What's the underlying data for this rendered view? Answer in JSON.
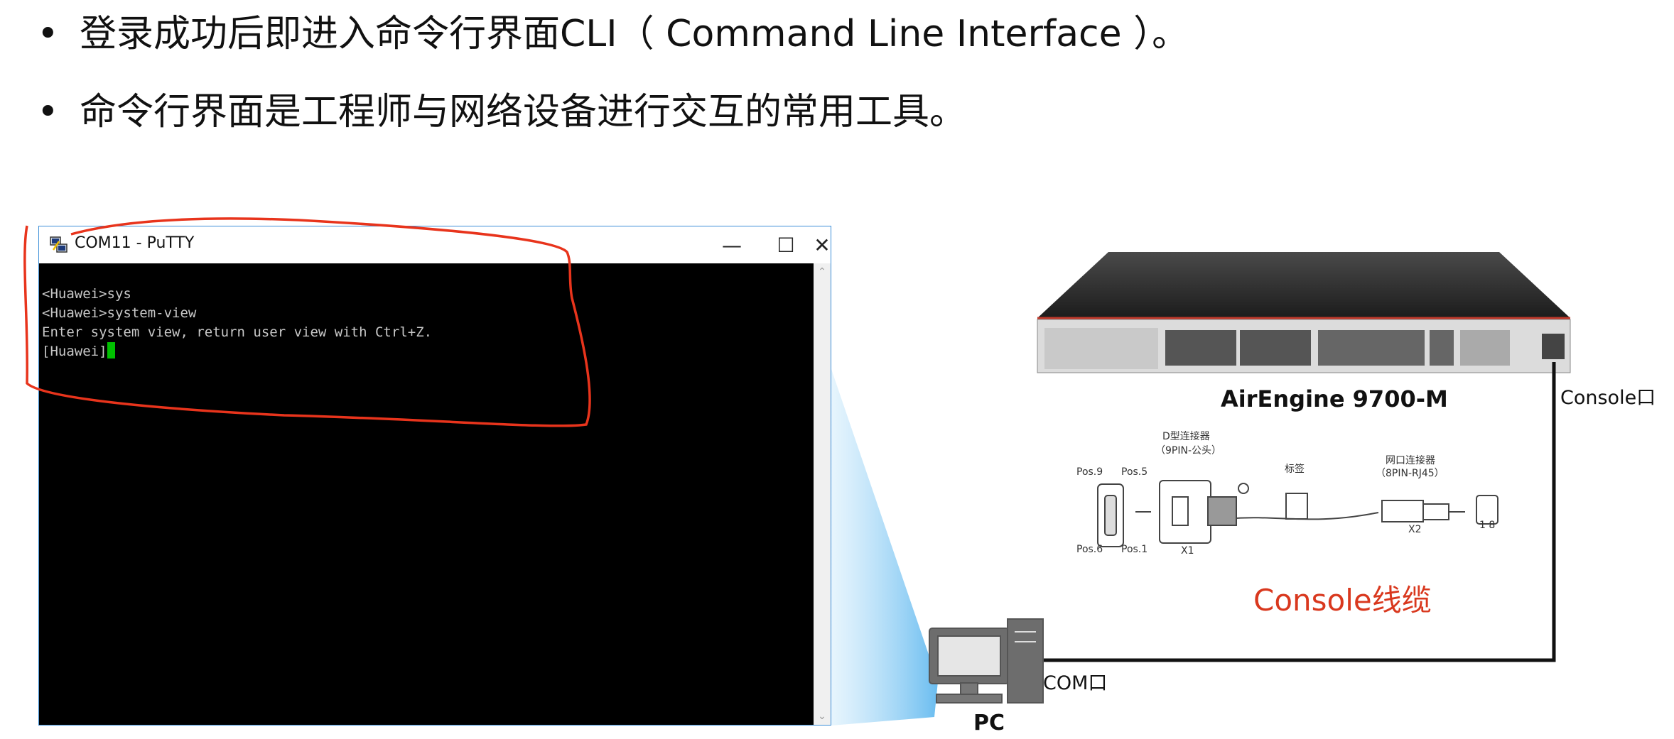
{
  "bullets": [
    "登录成功后即进入命令行界面CLI（ Command Line Interface ）。",
    "命令行界面是工程师与网络设备进行交互的常用工具。"
  ],
  "bullet_symbol": "•",
  "putty": {
    "title": "COM11 - PuTTY",
    "minimize": "—",
    "maximize": "☐",
    "close": "✕",
    "lines": [
      "<Huawei>sys",
      "<Huawei>system-view",
      "Enter system view, return user view with Ctrl+Z.",
      "[Huawei]"
    ]
  },
  "diagram": {
    "device_name": "AirEngine 9700-M",
    "console_port_label": "Console口",
    "cable_label": "Console线缆",
    "com_port_label": "COM口",
    "pc_label": "PC",
    "connector_d_type": "D型连接器",
    "connector_d_pins": "（9PIN-公头）",
    "connector_rj45": "网口连接器",
    "connector_rj45_pins": "（8PIN-RJ45）",
    "tag_label": "标签",
    "pos9": "Pos.9",
    "pos5": "Pos.5",
    "pos6": "Pos.6",
    "pos1": "Pos.1",
    "x1": "X1",
    "x2": "X2",
    "pin_range": "1  8"
  },
  "colors": {
    "accent_red": "#d9381e",
    "annotation_red": "#e8341c",
    "terminal_bg": "#000000",
    "terminal_text": "#c8c8c8",
    "cursor": "#00c000",
    "window_border": "#3c8ed8"
  }
}
